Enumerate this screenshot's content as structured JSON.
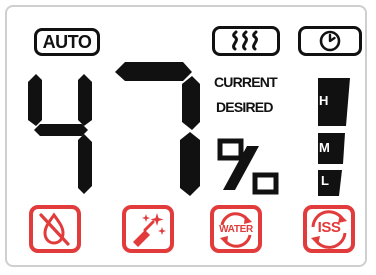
{
  "mode": {
    "label": "AUTO"
  },
  "humidity": {
    "value": "47",
    "unit": "%"
  },
  "status": {
    "current_label": "CURRENT",
    "desired_label": "DESIRED"
  },
  "fan_speed": {
    "levels": [
      "H",
      "M",
      "L"
    ]
  },
  "icons": {
    "heat": "heat-waves-icon",
    "timer": "timer-clock-icon",
    "no_water": "no-water-drop-icon",
    "clean": "clean-sparkle-icon",
    "water_refill": "water-refill-icon",
    "iss": "iss-icon"
  },
  "buttons": {
    "water_label": "WATER",
    "iss_label": "ISS"
  },
  "colors": {
    "segment": "#111111",
    "alert": "#e23b3b",
    "background": "#ffffff"
  }
}
